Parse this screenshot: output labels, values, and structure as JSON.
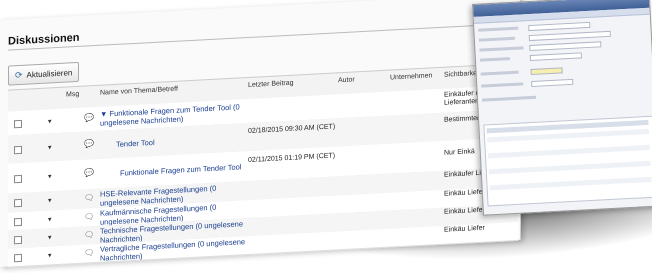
{
  "section": {
    "title": "Diskussionen"
  },
  "toolbar": {
    "refresh_label": "Aktualisieren"
  },
  "columns": {
    "msg": "Msg",
    "name": "Name von Thema/Betreff",
    "last": "Letzter Beitrag",
    "author": "Autor",
    "company": "Unternehmen",
    "visibility": "Sichtbarkeit"
  },
  "rows": [
    {
      "title": "▼ Funktionale Fragen zum Tender Tool (0 ungelesene Nachrichten)",
      "date": "",
      "visibility": "Einkäufer und Lieferanten"
    },
    {
      "title": "Tender Tool",
      "date": "02/18/2015 09:30 AM (CET)",
      "visibility": "Bestimmter Lieferant"
    },
    {
      "title": "Funktionale Fragen zum Tender Tool",
      "date": "02/11/2015 01:19 PM (CET)",
      "visibility": "Nur Einkä"
    },
    {
      "title": "HSE-Relevante Fragestellungen (0 ungelesene Nachrichten)",
      "date": "",
      "visibility": "Einkäufer Lieferan"
    },
    {
      "title": "Kaufmännische Fragestellungen (0 ungelesene Nachrichten)",
      "date": "",
      "visibility": "Einkäu Liefera"
    },
    {
      "title": "Technische Fragestellungen (0 ungelesene Nachrichten)",
      "date": "",
      "visibility": "Einkäu Liefera"
    },
    {
      "title": "Vertragliche Fragestellungen (0 ungelesene Nachrichten)",
      "date": "",
      "visibility": "Einkäu Liefer"
    }
  ]
}
